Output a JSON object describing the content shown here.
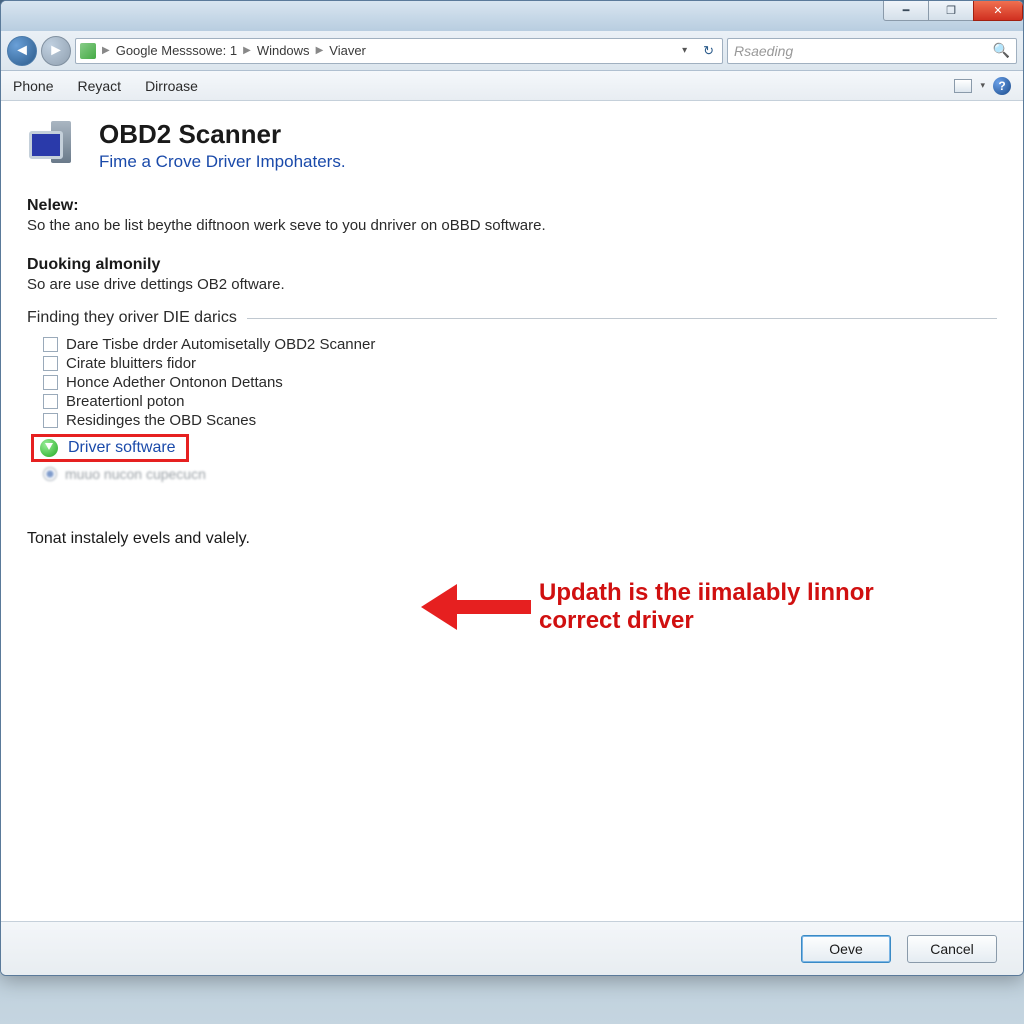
{
  "breadcrumb": {
    "seg1": "Google Messsowe: 1",
    "seg2": "Windows",
    "seg3": "Viaver"
  },
  "search": {
    "placeholder": "Rsaeding"
  },
  "menu": {
    "item1": "Phone",
    "item2": "Reyact",
    "item3": "Dirroase"
  },
  "header": {
    "title": "OBD2 Scanner",
    "subtitle": "Fime a Crove Driver Impohaters."
  },
  "sec1": {
    "label": "Nelew:",
    "body": "So the ano be list beythe diftnoon werk seve to you dnriver on oBBD software."
  },
  "sec2": {
    "label": "Duoking almonily",
    "body": "So are use drive dettings OB2 oftware."
  },
  "fieldset": {
    "legend": "Finding they oriver DIE darics",
    "opts": {
      "o1": "Dare Tisbe drder Automisetally OBD2 Scanner",
      "o2": "Cirate bluitters fidor",
      "o3": "Honce Adether Ontonon Dettans",
      "o4": "Breatertionl poton",
      "o5": "Residinges the OBD Scanes"
    },
    "link": "Driver software",
    "obscured": "muuo nucon cupecucn"
  },
  "callout": "Updath is the iimalably linnor correct driver",
  "footer_note": "Tonat instalely evels and valely.",
  "buttons": {
    "ok": "Oeve",
    "cancel": "Cancel"
  }
}
